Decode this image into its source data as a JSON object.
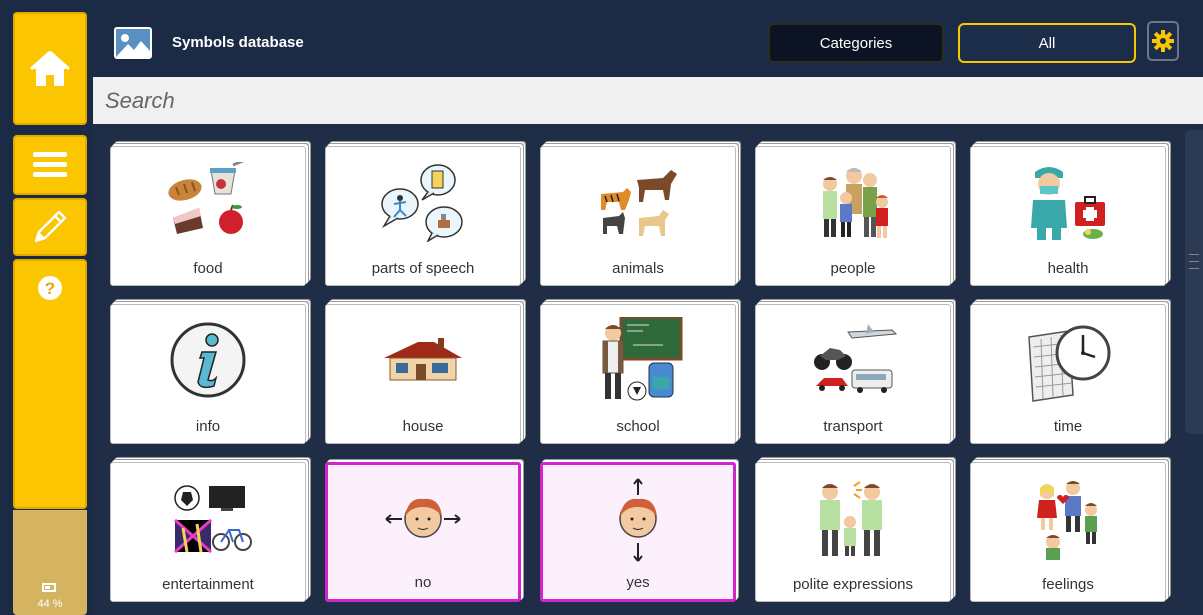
{
  "header": {
    "title": "Symbols database",
    "categories_label": "Categories",
    "all_label": "All"
  },
  "search": {
    "placeholder": "Search"
  },
  "status": {
    "battery_level": "44 %"
  },
  "icons": {
    "home": "home-icon",
    "menu": "menu-icon",
    "edit": "pencil-icon",
    "help": "help-icon",
    "settings": "gear-icon",
    "app": "image-icon"
  },
  "colors": {
    "accent": "#fbc600",
    "background": "#1b2b45",
    "highlight_border": "#d126cc"
  },
  "tiles": [
    {
      "label": "food"
    },
    {
      "label": "parts of speech"
    },
    {
      "label": "animals"
    },
    {
      "label": "people"
    },
    {
      "label": "health"
    },
    {
      "label": "info"
    },
    {
      "label": "house"
    },
    {
      "label": "school"
    },
    {
      "label": "transport"
    },
    {
      "label": "time"
    },
    {
      "label": "entertainment"
    },
    {
      "label": "no"
    },
    {
      "label": "yes"
    },
    {
      "label": "polite expressions"
    },
    {
      "label": "feelings"
    }
  ]
}
